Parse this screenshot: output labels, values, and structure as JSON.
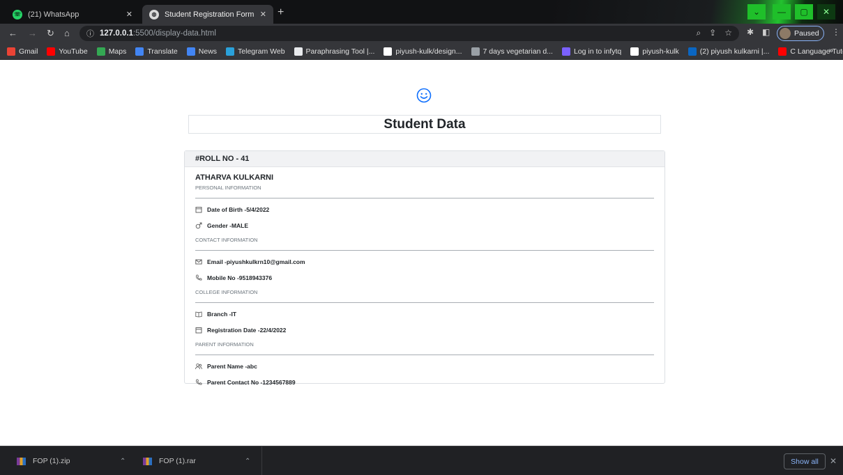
{
  "browser": {
    "tabs": [
      {
        "title": "(21) WhatsApp",
        "icon": "whatsapp-icon",
        "active": false
      },
      {
        "title": "Student Registration Form",
        "icon": "globe-icon",
        "active": true
      }
    ],
    "url_host": "127.0.0.1",
    "url_path": ":5500/display-data.html",
    "profile_status": "Paused",
    "bookmarks": [
      {
        "label": "Gmail",
        "icon": "gmail-icon",
        "color": "#ea4335"
      },
      {
        "label": "YouTube",
        "icon": "youtube-icon",
        "color": "#ff0000"
      },
      {
        "label": "Maps",
        "icon": "maps-icon",
        "color": "#34a853"
      },
      {
        "label": "Translate",
        "icon": "translate-icon",
        "color": "#4285f4"
      },
      {
        "label": "News",
        "icon": "news-icon",
        "color": "#4285f4"
      },
      {
        "label": "Telegram Web",
        "icon": "telegram-icon",
        "color": "#2aa1da"
      },
      {
        "label": "Paraphrasing Tool |...",
        "icon": "quill-icon",
        "color": "#e8eaed"
      },
      {
        "label": "piyush-kulk/design...",
        "icon": "github-icon",
        "color": "#ffffff"
      },
      {
        "label": "7 days vegetarian d...",
        "icon": "page-icon",
        "color": "#9aa0a6"
      },
      {
        "label": "Log in to infytq",
        "icon": "infytq-icon",
        "color": "#7b61ff"
      },
      {
        "label": "piyush-kulk",
        "icon": "github-icon",
        "color": "#ffffff"
      },
      {
        "label": "(2) piyush kulkarni |...",
        "icon": "linkedin-icon",
        "color": "#0a66c2"
      },
      {
        "label": "C Language Tutoria...",
        "icon": "youtube-icon",
        "color": "#ff0000"
      }
    ],
    "bookmarks_more": "»"
  },
  "page": {
    "heading": "Student Data",
    "roll_label": "#ROLL NO - 41",
    "student_name": "ATHARVA KULKARNI",
    "sections": {
      "personal": "PERSONAL INFORMATION",
      "contact": "CONTACT INFORMATION",
      "college": "COLLEGE INFORMATION",
      "parent": "PARENT INFORMATION"
    },
    "fields": {
      "dob": "Date of Birth -5/4/2022",
      "gender": "Gender -MALE",
      "email": "Email -piyushkulkrn10@gmail.com",
      "mobile": "Mobile No -9518943376",
      "branch": "Branch -IT",
      "registration_date": "Registration Date -22/4/2022",
      "parent_name": "Parent Name -abc",
      "parent_contact": "Parent Contact No -1234567889"
    }
  },
  "downloads": {
    "items": [
      {
        "name": "FOP (1).zip",
        "icon": "winrar-archive-icon"
      },
      {
        "name": "FOP (1).rar",
        "icon": "winrar-archive-icon"
      }
    ],
    "show_all": "Show all",
    "close": "✕"
  }
}
